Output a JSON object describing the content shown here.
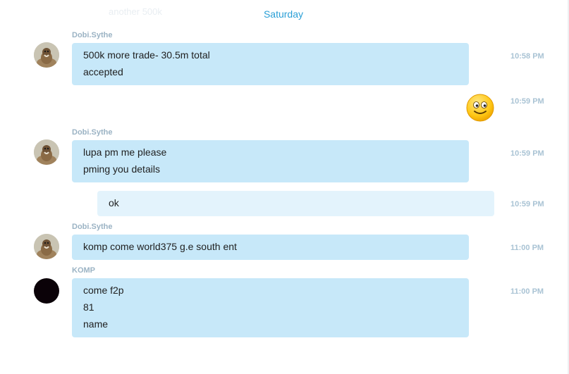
{
  "top": {
    "faded_previous_text": "another 500k",
    "day_separator": "Saturday"
  },
  "messages": [
    {
      "sender": "Dobi.Sythe",
      "lines": [
        "500k more trade- 30.5m total",
        "accepted"
      ],
      "time": "10:58 PM"
    },
    {
      "emoji": "smile-emoticon",
      "time": "10:59 PM"
    },
    {
      "sender": "Dobi.Sythe",
      "lines": [
        "lupa pm me please",
        "pming you details"
      ],
      "time": "10:59 PM"
    },
    {
      "lines": [
        "ok"
      ],
      "time": "10:59 PM"
    },
    {
      "sender": "Dobi.Sythe",
      "lines": [
        "komp come world375 g.e south ent"
      ],
      "time": "11:00 PM"
    },
    {
      "sender": "KOMP",
      "lines": [
        "come f2p",
        "81",
        "name"
      ],
      "time": "11:00 PM"
    }
  ],
  "colors": {
    "incoming_bubble": "#c7e8f9",
    "outgoing_bubble": "#e3f3fc",
    "day_separator": "#2a9fd6",
    "sender_name": "#9bb3c4",
    "timestamp": "#a9c3d4"
  }
}
